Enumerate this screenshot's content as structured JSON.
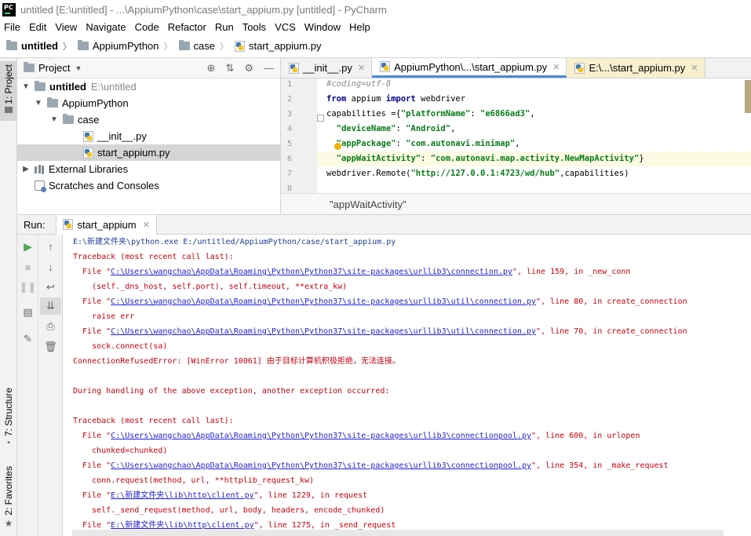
{
  "window": {
    "title": "untitled [E:\\untitled] - ...\\AppiumPython\\case\\start_appium.py [untitled] - PyCharm",
    "logo": "PC"
  },
  "menu": [
    "File",
    "Edit",
    "View",
    "Navigate",
    "Code",
    "Refactor",
    "Run",
    "Tools",
    "VCS",
    "Window",
    "Help"
  ],
  "breadcrumbs": [
    "untitled",
    "AppiumPython",
    "case",
    "start_appium.py"
  ],
  "left_stripe": {
    "project": "1: Project",
    "structure": "7: Structure",
    "favorites": "2: Favorites"
  },
  "project_panel": {
    "title": "Project",
    "tree": [
      {
        "label": "untitled",
        "extra": "E:\\untitled",
        "arrow": "▼",
        "icon": "folder-icon"
      },
      {
        "label": "AppiumPython",
        "arrow": "▼",
        "icon": "folder-icon"
      },
      {
        "label": "case",
        "arrow": "▼",
        "icon": "folder-icon"
      },
      {
        "label": "__init__.py",
        "arrow": "",
        "icon": "python-file-icon"
      },
      {
        "label": "start_appium.py",
        "arrow": "",
        "icon": "python-file-icon",
        "selected": true
      },
      {
        "label": "External Libraries",
        "arrow": "▶",
        "icon": "library-icon"
      },
      {
        "label": "Scratches and Consoles",
        "arrow": "",
        "icon": "scratch-icon"
      }
    ]
  },
  "editor": {
    "tabs": [
      "__init__.py",
      "AppiumPython\\...\\start_appium.py",
      "E:\\...\\start_appium.py"
    ],
    "line_numbers": [
      "1",
      "2",
      "3",
      "4",
      "5",
      "6",
      "7",
      "8"
    ],
    "code": {
      "l1": "#coding=utf-8",
      "l2_kw1": "from",
      "l2_mod": " appium ",
      "l2_kw2": "import",
      "l2_rest": " webdriver",
      "l3_a": "capabilities ={",
      "l3_k": "\"platformName\"",
      "l3_b": ": ",
      "l3_v": "\"e6866ad3\"",
      "l3_c": ",",
      "l4_k": "  \"deviceName\"",
      "l4_b": ": ",
      "l4_v": "\"Android\"",
      "l4_c": ",",
      "l5_k": "  \"appPackage\"",
      "l5_b": ": ",
      "l5_v": "\"com.autonavi.minimap\"",
      "l5_c": ",",
      "l6_k": "  \"appWaitActivity\"",
      "l6_b": ": ",
      "l6_v": "\"com.autonavi.map.activity.NewMapActivity\"",
      "l6_c": "}",
      "l7_a": "webdriver.Remote(",
      "l7_v": "\"http://127.0.0.1:4723/wd/hub\"",
      "l7_c": ",capabilities)"
    },
    "status_crumb": "\"appWaitActivity\""
  },
  "run": {
    "label": "Run:",
    "tab": "start_appium",
    "console": {
      "c1": "E:\\新建文件夹\\python.exe E:/untitled/AppiumPython/case/start_appium.py",
      "c2": "Traceback (most recent call last):",
      "c3_a": "  File \"",
      "c3_l": "C:\\Users\\wangchao\\AppData\\Roaming\\Python\\Python37\\site-packages\\urllib3\\connection.py",
      "c3_b": "\", line 159, in _new_conn",
      "c4": "    (self._dns_host, self.port), self.timeout, **extra_kw)",
      "c5_a": "  File \"",
      "c5_l": "C:\\Users\\wangchao\\AppData\\Roaming\\Python\\Python37\\site-packages\\urllib3\\util\\connection.py",
      "c5_b": "\", line 80, in create_connection",
      "c6": "    raise err",
      "c7_a": "  File \"",
      "c7_l": "C:\\Users\\wangchao\\AppData\\Roaming\\Python\\Python37\\site-packages\\urllib3\\util\\connection.py",
      "c7_b": "\", line 70, in create_connection",
      "c8": "    sock.connect(sa)",
      "c9": "ConnectionRefusedError: [WinError 10061] 由于目标计算机积极拒绝，无法连接。",
      "c10": "During handling of the above exception, another exception occurred:",
      "c11": "Traceback (most recent call last):",
      "c12_a": "  File \"",
      "c12_l": "C:\\Users\\wangchao\\AppData\\Roaming\\Python\\Python37\\site-packages\\urllib3\\connectionpool.py",
      "c12_b": "\", line 600, in urlopen",
      "c13": "    chunked=chunked)",
      "c14_a": "  File \"",
      "c14_l": "C:\\Users\\wangchao\\AppData\\Roaming\\Python\\Python37\\site-packages\\urllib3\\connectionpool.py",
      "c14_b": "\", line 354, in _make_request",
      "c15": "    conn.request(method, url, **httplib_request_kw)",
      "c16_a": "  File \"",
      "c16_l": "E:\\新建文件夹\\lib\\http\\client.py",
      "c16_b": "\", line 1229, in request",
      "c17": "    self._send_request(method, url, body, headers, encode_chunked)",
      "c18_a": "  File \"",
      "c18_l": "E:\\新建文件夹\\lib\\http\\client.py",
      "c18_b": "\", line 1275, in _send_request"
    }
  }
}
